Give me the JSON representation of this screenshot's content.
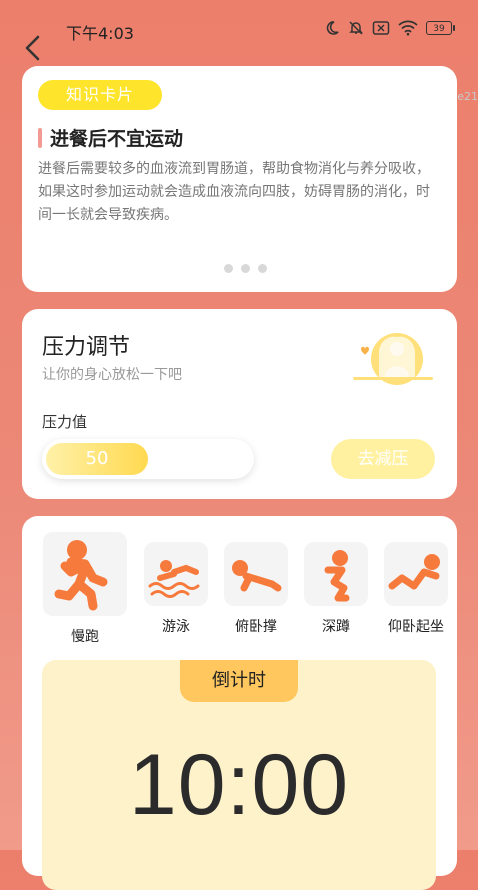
{
  "status": {
    "time": "下午4:03",
    "battery": "39",
    "icons": [
      "moon-icon",
      "bell-muted-icon",
      "no-sim-icon",
      "wifi-icon",
      "battery-icon"
    ]
  },
  "watermark": "e21",
  "knowledge": {
    "badge": "知识卡片",
    "title": "进餐后不宜运动",
    "body": "进餐后需要较多的血液流到胃肠道，帮助食物消化与养分吸收，如果这时参加运动就会造成血液流向四肢，妨碍胃肠的消化，时间一长就会导致疾病。",
    "pages": 3
  },
  "pressure": {
    "title": "压力调节",
    "subtitle": "让你的身心放松一下吧",
    "label": "压力值",
    "value": "50",
    "value_fraction": 0.5,
    "button": "去减压"
  },
  "exercises": [
    {
      "label": "慢跑",
      "icon": "running-icon",
      "selected": true
    },
    {
      "label": "游泳",
      "icon": "swimming-icon",
      "selected": false
    },
    {
      "label": "俯卧撑",
      "icon": "pushup-icon",
      "selected": false
    },
    {
      "label": "深蹲",
      "icon": "squat-icon",
      "selected": false
    },
    {
      "label": "仰卧起坐",
      "icon": "situp-icon",
      "selected": false
    }
  ],
  "countdown": {
    "label": "倒计时",
    "time": "10:00"
  },
  "colors": {
    "background": "#ec7f6c",
    "accent_yellow": "#ffe42c",
    "icon_orange": "#f67a3c"
  }
}
